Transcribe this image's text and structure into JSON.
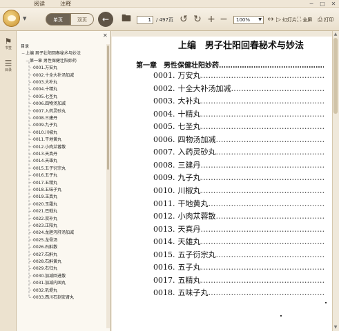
{
  "menu_tabs": [
    {
      "label": "阅读"
    },
    {
      "label": "注释"
    }
  ],
  "toolbar": {
    "single_label": "单页",
    "double_label": "双页",
    "page_current": "1",
    "page_total": "/ 497页",
    "zoom_value": "100%",
    "slideshow_label": "幻灯片",
    "fullscreen_label": "全屏",
    "print_label": "打印"
  },
  "rail": {
    "items": [
      {
        "label": "书签"
      },
      {
        "label": "目录"
      }
    ]
  },
  "sidebar": {
    "title": "目录",
    "items": [
      {
        "label": "目录",
        "level": 0
      },
      {
        "label": "上编 男子壮阳回春秘术与妙法",
        "level": 1
      },
      {
        "label": "第一章 男性保健壮阳妙药",
        "level": 2
      },
      {
        "label": "0001.万安丸",
        "level": 3
      },
      {
        "label": "0002.十全大补汤加减",
        "level": 3
      },
      {
        "label": "0003.大补丸",
        "level": 3
      },
      {
        "label": "0004.十精丸",
        "level": 3
      },
      {
        "label": "0005.七圣丸",
        "level": 3
      },
      {
        "label": "0006.四物汤加减",
        "level": 3
      },
      {
        "label": "0007.入药灵砂丸",
        "level": 3
      },
      {
        "label": "0008.三建丹",
        "level": 3
      },
      {
        "label": "0009.九子丸",
        "level": 3
      },
      {
        "label": "0010.川椒丸",
        "level": 3
      },
      {
        "label": "0011.干地黄丸",
        "level": 3
      },
      {
        "label": "0012.小肉苁蓉散",
        "level": 3
      },
      {
        "label": "0013.天真丹",
        "level": 3
      },
      {
        "label": "0014.天雄丸",
        "level": 3
      },
      {
        "label": "0015.五子衍宗丸",
        "level": 3
      },
      {
        "label": "0016.五子丸",
        "level": 3
      },
      {
        "label": "0017.五精丸",
        "level": 3
      },
      {
        "label": "0018.五味子丸",
        "level": 3
      },
      {
        "label": "0019.玉真丸",
        "level": 3
      },
      {
        "label": "0020.玉霜丸",
        "level": 3
      },
      {
        "label": "0021.巴戟丸",
        "level": 3
      },
      {
        "label": "0022.双补丸",
        "level": 3
      },
      {
        "label": "0023.正阳丸",
        "level": 3
      },
      {
        "label": "0024.龙胆泻肝汤加减",
        "level": 3
      },
      {
        "label": "0025.龙骨汤",
        "level": 3
      },
      {
        "label": "0026.石斛散",
        "level": 3
      },
      {
        "label": "0027.石斛丸",
        "level": 3
      },
      {
        "label": "0028.石斛黄丸",
        "level": 3
      },
      {
        "label": "0029.右归丸",
        "level": 3
      },
      {
        "label": "0030.加减回进散",
        "level": 3
      },
      {
        "label": "0031.加减内固丸",
        "level": 3
      },
      {
        "label": "0032.巩堤丸",
        "level": 3
      },
      {
        "label": "0033.西川石刻安肾丸",
        "level": 3
      }
    ]
  },
  "document": {
    "part_title": "上编　男子壮阳回春秘术与妙法",
    "chapter_title": "第一章　男性保健壮阳妙药",
    "dot_leader": "……………………………………………………………………………",
    "entries": [
      {
        "num": "0001.",
        "name": "万安丸"
      },
      {
        "num": "0002.",
        "name": "十全大补汤加减"
      },
      {
        "num": "0003.",
        "name": "大补丸"
      },
      {
        "num": "0004.",
        "name": "十精丸"
      },
      {
        "num": "0005.",
        "name": "七圣丸"
      },
      {
        "num": "0006.",
        "name": "四物汤加减"
      },
      {
        "num": "0007.",
        "name": "入药灵砂丸"
      },
      {
        "num": "0008.",
        "name": "三建丹"
      },
      {
        "num": "0009.",
        "name": "九子丸"
      },
      {
        "num": "0010.",
        "name": "川椒丸"
      },
      {
        "num": "0011.",
        "name": "干地黄丸"
      },
      {
        "num": "0012.",
        "name": "小肉苁蓉散"
      },
      {
        "num": "0013.",
        "name": "天真丹"
      },
      {
        "num": "0014.",
        "name": "天雄丸"
      },
      {
        "num": "0015.",
        "name": "五子衍宗丸"
      },
      {
        "num": "0016.",
        "name": "五子丸"
      },
      {
        "num": "0017.",
        "name": "五精丸"
      },
      {
        "num": "0018.",
        "name": "五味子丸"
      }
    ]
  }
}
